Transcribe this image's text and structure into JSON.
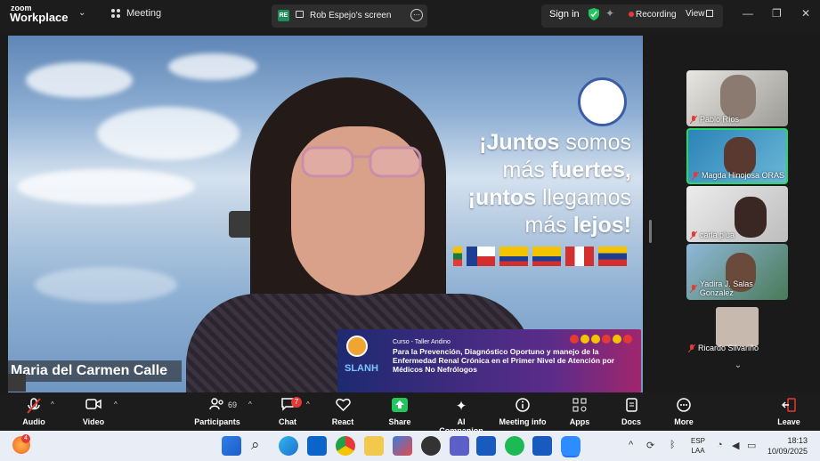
{
  "app": {
    "logo_top": "zoom",
    "logo_bottom": "Workplace",
    "tab": "Meeting"
  },
  "share": {
    "badge": "RE",
    "label": "Rob Espejo's screen"
  },
  "header": {
    "signin": "Sign in",
    "recording": "Recording",
    "view": "View"
  },
  "slide": {
    "line1_bold": "¡Juntos",
    "line1_rest": " somos",
    "line2_pre": "más ",
    "line2_bold": "fuertes,",
    "line3_bold": "¡untos",
    "line3_rest": " llegamos",
    "line4_pre": "más ",
    "line4_bold": "lejos!",
    "banner_sub": "Curso - Taller Andino",
    "banner_title": "Para la Prevención, Diagnóstico Oportuno y manejo de la Enfermedad Renal Crónica en el Primer Nivel de Atención por Médicos No Nefrólogos",
    "banner_logo": "SLANH"
  },
  "speaker": {
    "name": "Maria del Carmen Calle"
  },
  "participants": [
    {
      "name": "Pablo Ríos"
    },
    {
      "name": "Magda Hinojosa ORAS"
    },
    {
      "name": "carla plua"
    },
    {
      "name": "Yadira J. Salas Gonzalez"
    },
    {
      "name": "Ricardo Silvariño"
    }
  ],
  "toolbar": {
    "audio": "Audio",
    "video": "Video",
    "participants": "Participants",
    "participants_count": "69",
    "chat": "Chat",
    "chat_badge": "7",
    "react": "React",
    "share": "Share",
    "ai": "AI Companion",
    "info": "Meeting info",
    "apps": "Apps",
    "docs": "Docs",
    "more": "More",
    "leave": "Leave"
  },
  "taskbar": {
    "notif_badge": "4",
    "lang1": "ESP",
    "lang2": "LAA",
    "time": "18:13",
    "date": "10/09/2025"
  },
  "colors": {
    "recording": "#e53935",
    "share_green": "#22c55e",
    "active_tile": "#2bd66a"
  }
}
